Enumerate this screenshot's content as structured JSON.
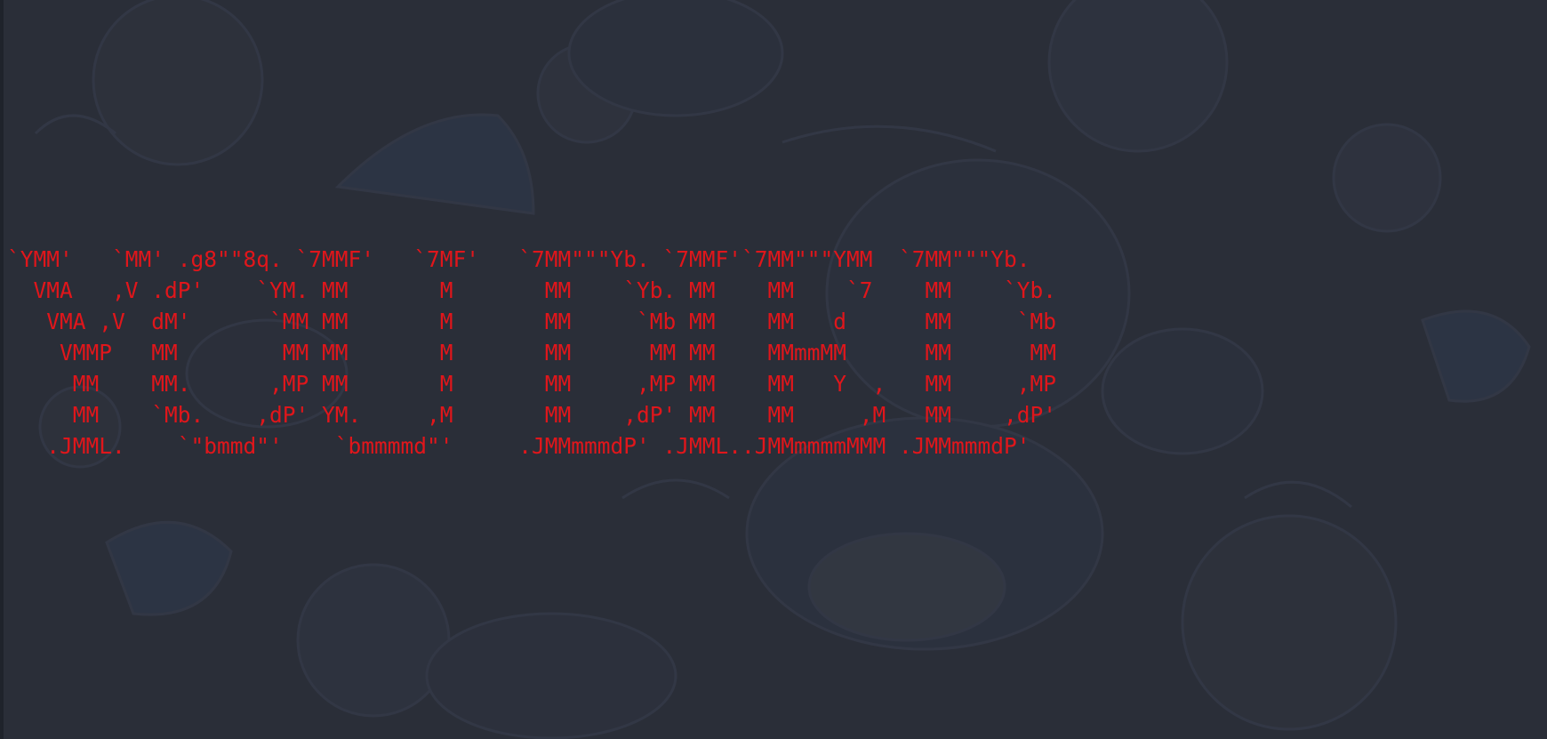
{
  "terminal": {
    "banner_lines": [
      "`YMM'   `MM' .g8\"\"8q. `7MMF'   `7MF'   `7MM\"\"\"Yb. `7MMF'`7MM\"\"\"YMM  `7MM\"\"\"Yb.",
      "  VMA   ,V .dP'    `YM. MM       M       MM    `Yb. MM    MM    `7    MM    `Yb.",
      "   VMA ,V  dM'      `MM MM       M       MM     `Mb MM    MM   d      MM     `Mb",
      "    VMMP   MM        MM MM       M       MM      MM MM    MMmmMM      MM      MM",
      "     MM    MM.      ,MP MM       M       MM     ,MP MM    MM   Y  ,   MM     ,MP",
      "     MM    `Mb.    ,dP' YM.     ,M       MM    ,dP' MM    MM     ,M   MM    ,dP'",
      "   .JMML.    `\"bmmd\"'    `bmmmmd\"'     .JMMmmmdP' .JMML..JMMmmmmMMM .JMMmmmdP'"
    ],
    "text_color": "#e0161b",
    "background_color": "#2a2e38"
  },
  "wallpaper": {
    "description_icon": "anime-santa-hat-pattern"
  }
}
